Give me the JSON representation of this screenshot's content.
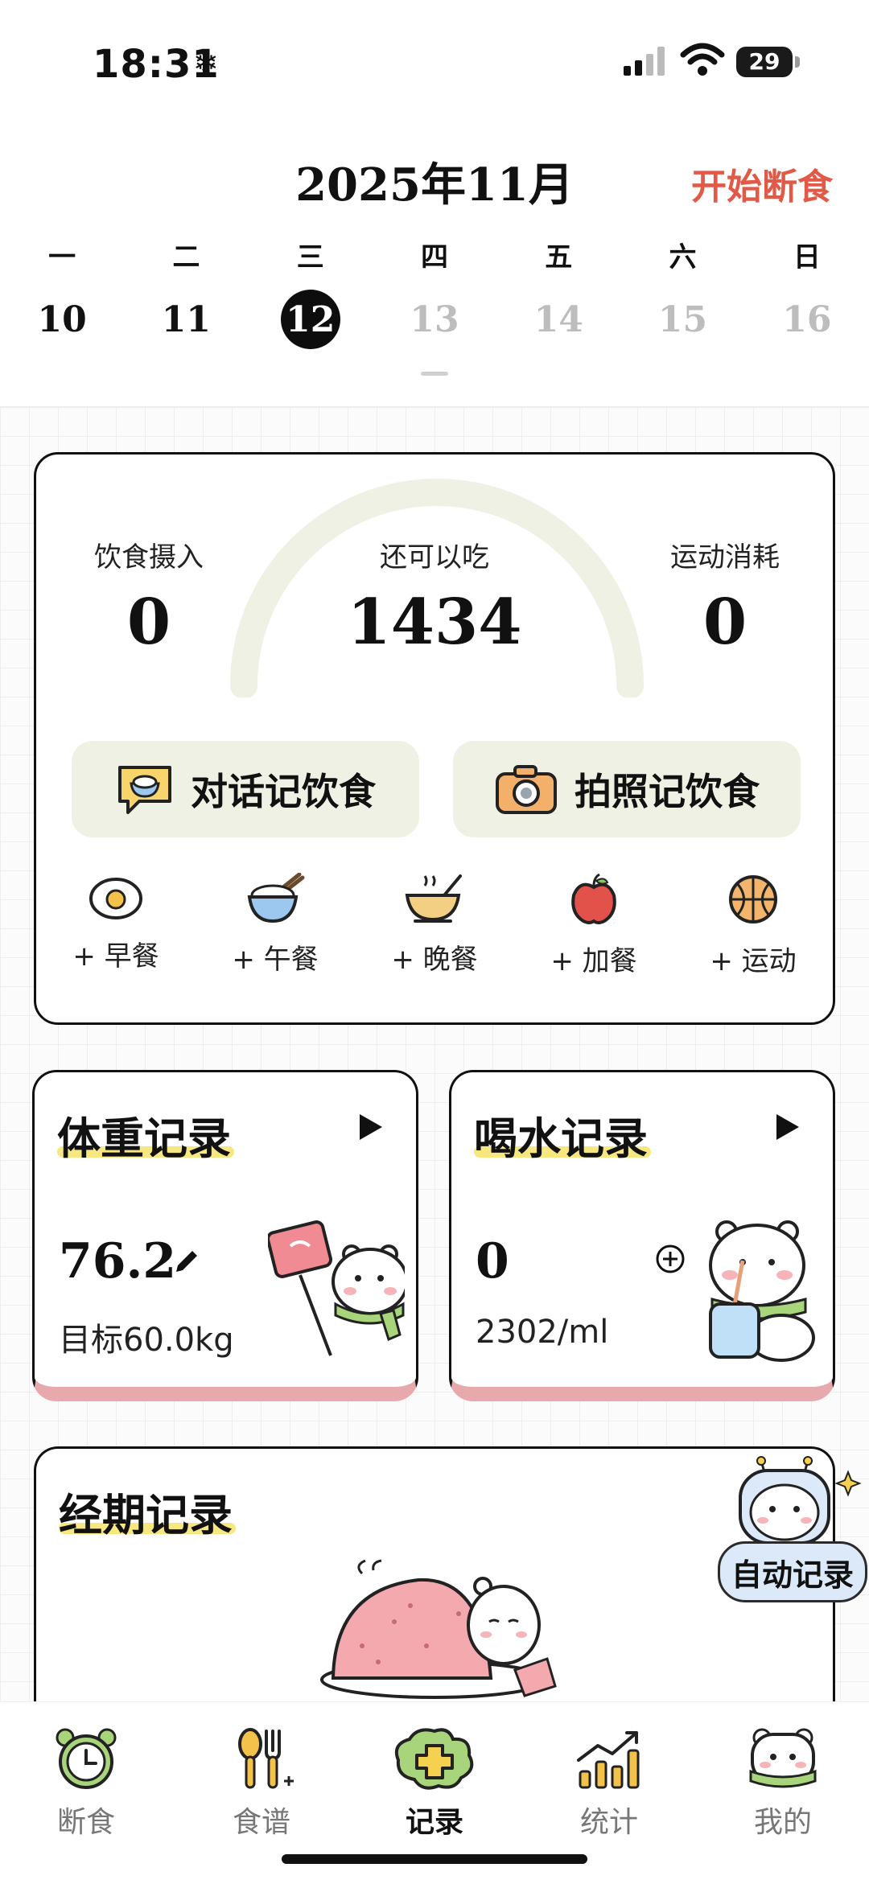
{
  "status_bar": {
    "time": "18:31",
    "battery": "29"
  },
  "header": {
    "month_title": "2025年11月",
    "start_fast": "开始断食"
  },
  "calendar": {
    "weekdays": [
      "一",
      "二",
      "三",
      "四",
      "五",
      "六",
      "日"
    ],
    "dates": [
      "10",
      "11",
      "12",
      "13",
      "14",
      "15",
      "16"
    ],
    "selected": "12"
  },
  "calories": {
    "intake_label": "饮食摄入",
    "intake_value": "0",
    "remaining_label": "还可以吃",
    "remaining_value": "1434",
    "burn_label": "运动消耗",
    "burn_value": "0",
    "chat_button": "对话记饮食",
    "photo_button": "拍照记饮食",
    "meals": [
      "+ 早餐",
      "+ 午餐",
      "+ 晚餐",
      "+ 加餐",
      "+ 运动"
    ]
  },
  "weight": {
    "title": "体重记录",
    "value": "76.2",
    "target": "目标60.0kg"
  },
  "water": {
    "title": "喝水记录",
    "value": "0",
    "target": "2302/ml"
  },
  "period": {
    "title": "经期记录",
    "badge": "自动记录"
  },
  "tabs": [
    "断食",
    "食谱",
    "记录",
    "统计",
    "我的"
  ],
  "colors": {
    "accent": "#e05a47",
    "button_bg": "#eef1e3",
    "card_bottom": "#e8a9ad",
    "highlight": "#f6e36a"
  }
}
